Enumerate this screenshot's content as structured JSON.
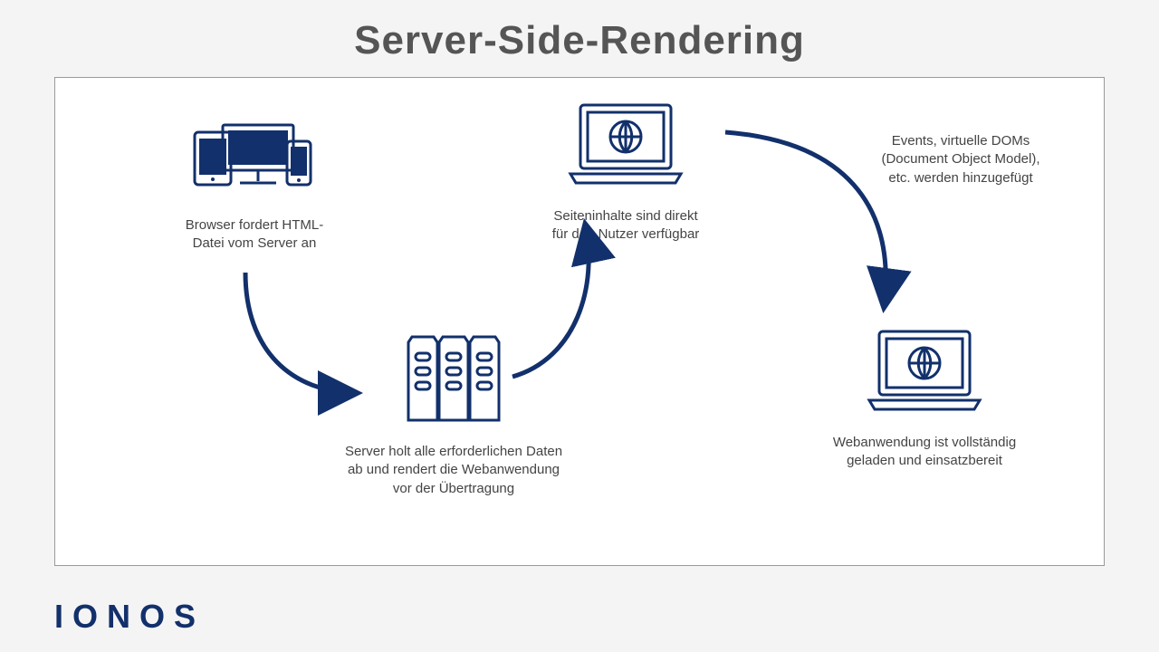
{
  "title": "Server-Side-Rendering",
  "nodes": {
    "devices": {
      "caption": "Browser fordert HTML-\nDatei vom Server an"
    },
    "server": {
      "caption": "Server holt alle erforderlichen Daten\nab und rendert die Webanwendung\nvor der Übertragung"
    },
    "laptop1": {
      "caption": "Seiteninhalte sind direkt\nfür den Nutzer verfügbar"
    },
    "events": {
      "caption": "Events, virtuelle DOMs\n(Document Object Model),\netc. werden hinzugefügt"
    },
    "laptop2": {
      "caption": "Webanwendung ist vollständig\ngeladen und einsatzbereit"
    }
  },
  "brand": "IONOS",
  "colors": {
    "ink": "#12306b"
  }
}
